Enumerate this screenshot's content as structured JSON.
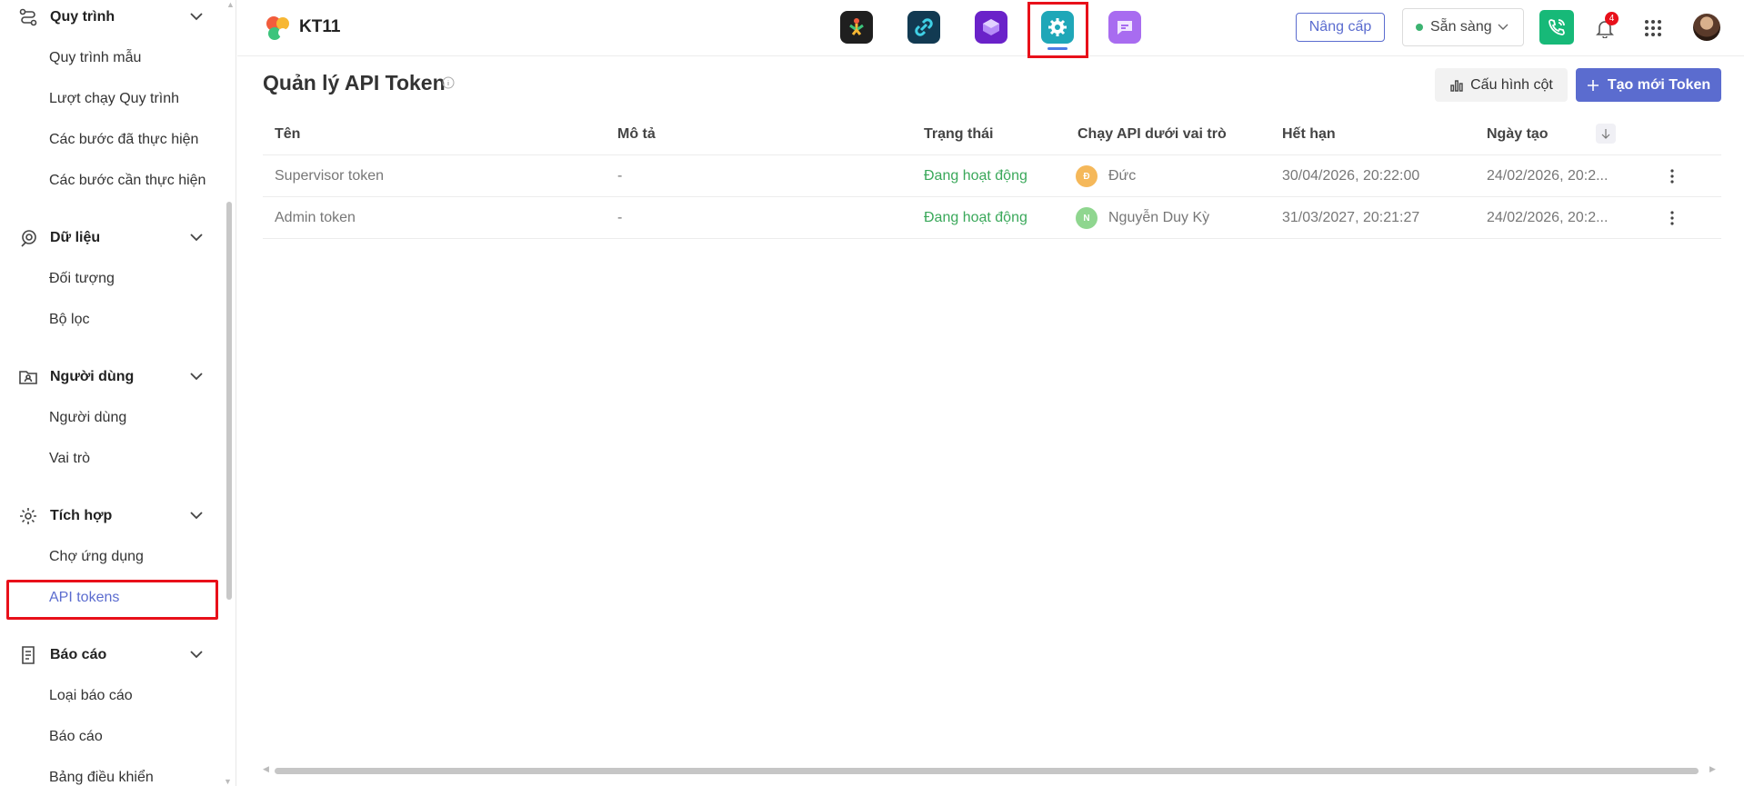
{
  "sidebar": {
    "groups": [
      {
        "label": "Quy trình",
        "icon": "workflow-icon",
        "items": [
          "Quy trình mẫu",
          "Lượt chạy Quy trình",
          "Các bước đã thực hiện",
          "Các bước cần thực hiện"
        ]
      },
      {
        "label": "Dữ liệu",
        "icon": "data-icon",
        "items": [
          "Đối tượng",
          "Bộ lọc"
        ]
      },
      {
        "label": "Người dùng",
        "icon": "user-folder-icon",
        "items": [
          "Người dùng",
          "Vai trò"
        ]
      },
      {
        "label": "Tích hợp",
        "icon": "gear-icon",
        "items": [
          "Chợ ứng dụng",
          "API tokens"
        ]
      },
      {
        "label": "Báo cáo",
        "icon": "report-icon",
        "items": [
          "Loại báo cáo",
          "Báo cáo",
          "Bảng điều khiển"
        ]
      }
    ],
    "active_item": "API tokens"
  },
  "topbar": {
    "workspace": "KT11",
    "apps": [
      "app-workflow-icon",
      "app-link-icon",
      "app-box-icon",
      "app-settings-icon",
      "app-chat-icon"
    ],
    "upgrade_label": "Nâng cấp",
    "status_label": "Sẵn sàng",
    "notification_count": "4"
  },
  "main": {
    "title": "Quản lý API Token",
    "config_label": "Cấu hình cột",
    "new_label": "Tạo mới Token",
    "columns": [
      "Tên",
      "Mô tả",
      "Trạng thái",
      "Chạy API dưới vai trò",
      "Hết hạn",
      "Ngày tạo"
    ],
    "rows": [
      {
        "name": "Supervisor token",
        "desc": "-",
        "status": "Đang hoạt động",
        "role_initial": "Đ",
        "role_color": "#f5b85a",
        "role": "Đức",
        "expires": "30/04/2026, 20:22:00",
        "created": "24/02/2026, 20:2..."
      },
      {
        "name": "Admin token",
        "desc": "-",
        "status": "Đang hoạt động",
        "role_initial": "N",
        "role_color": "#8fd68f",
        "role": "Nguyễn Duy Kỳ",
        "expires": "31/03/2027, 20:21:27",
        "created": "24/02/2026, 20:2..."
      }
    ]
  },
  "colors": {
    "accent": "#5b6ccf",
    "active_status": "#3aa85a",
    "highlight": "#e8101a"
  }
}
